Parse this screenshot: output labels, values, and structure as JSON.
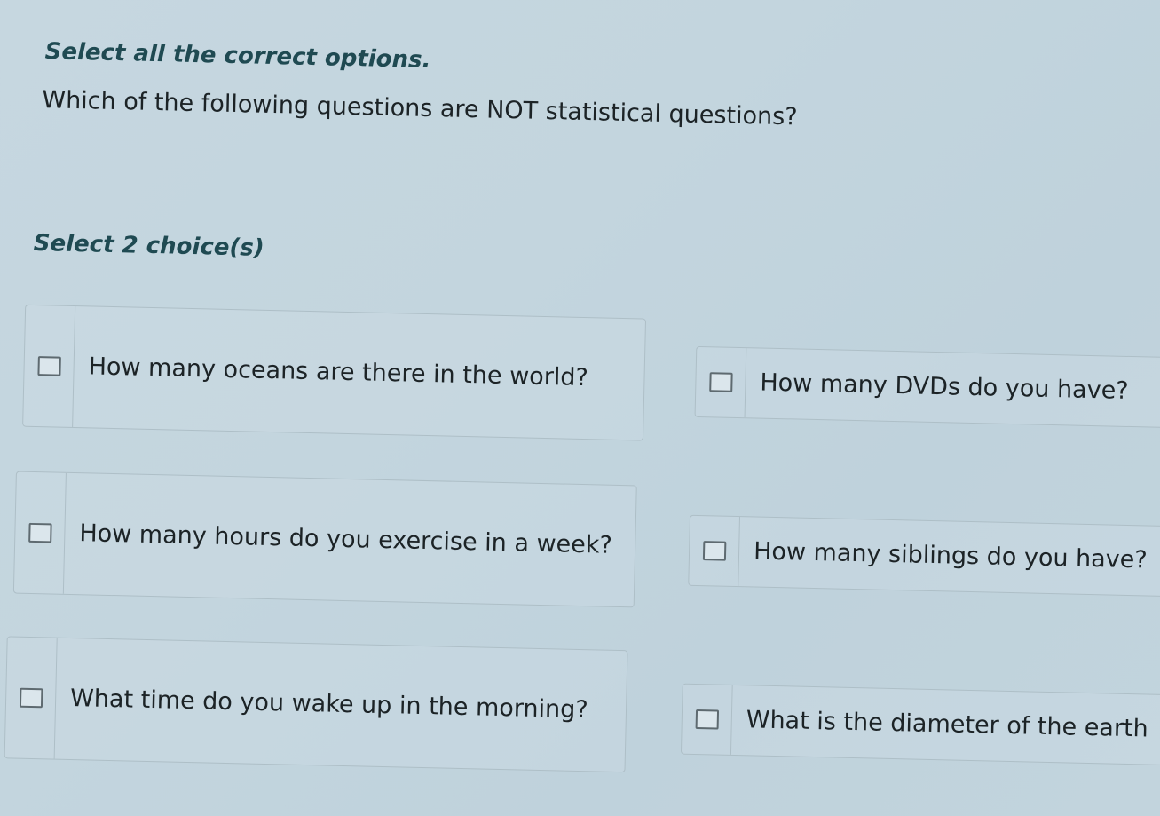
{
  "instruction": "Select all the correct options.",
  "question": "Which of the following questions are NOT statistical questions?",
  "select_count": "Select 2 choice(s)",
  "choices": [
    {
      "text": "How many oceans are there in the world?",
      "checked": false
    },
    {
      "text": "How many DVDs do you have?",
      "checked": false
    },
    {
      "text": "How many hours do you exercise in a week?",
      "checked": false
    },
    {
      "text": "How many siblings do you have?",
      "checked": false
    },
    {
      "text": "What time do you wake up in the morning?",
      "checked": false
    },
    {
      "text": "What is the diameter of the earth",
      "checked": false
    }
  ]
}
